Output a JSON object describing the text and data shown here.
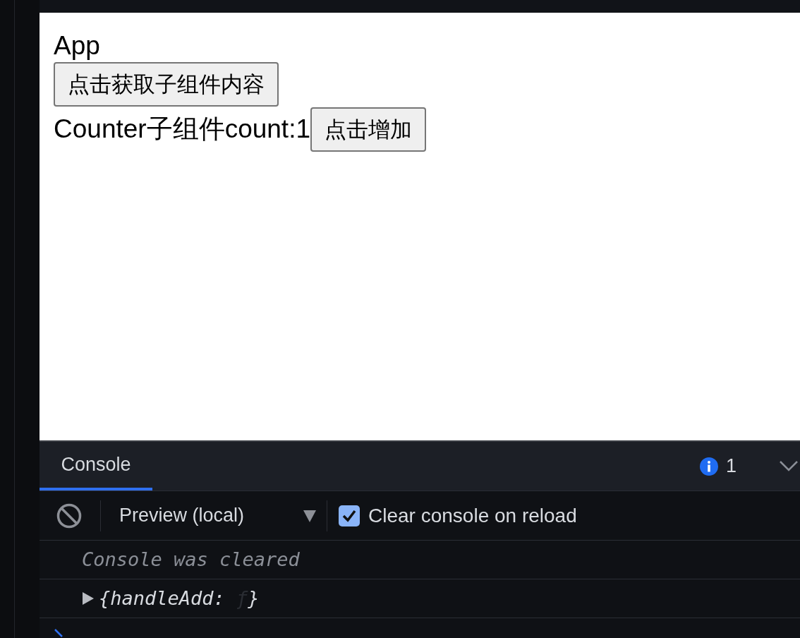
{
  "preview": {
    "heading": "App",
    "fetch_button": "点击获取子组件内容",
    "counter_label": "Counter子组件count:1",
    "add_button": "点击增加"
  },
  "console": {
    "tabs": [
      {
        "label": "Console",
        "selected": true
      }
    ],
    "info_count": "1",
    "context": "Preview (local)",
    "clear_on_reload": {
      "label": "Clear console on reload",
      "checked": true
    },
    "messages": [
      {
        "kind": "note",
        "text": "Console was cleared"
      },
      {
        "kind": "object",
        "open": "{handleAdd: ",
        "value": "ƒ",
        "close": "}"
      }
    ]
  }
}
